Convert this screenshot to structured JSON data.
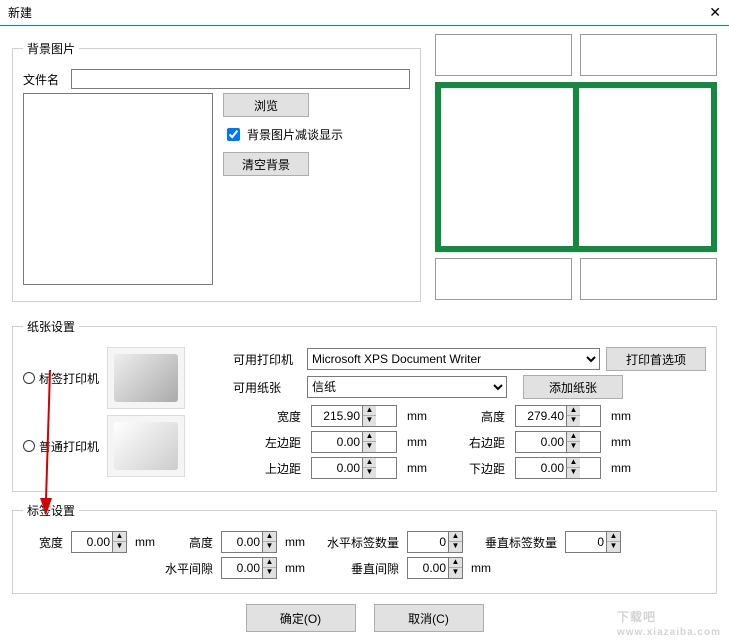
{
  "window": {
    "title": "新建"
  },
  "bg_image": {
    "legend": "背景图片",
    "filename_label": "文件名",
    "filename_value": "",
    "browse_btn": "浏览",
    "fade_checkbox": "背景图片减谈显示",
    "fade_checked": true,
    "clear_btn": "清空背景"
  },
  "paper": {
    "legend": "纸张设置",
    "radio_label_printer": "标签打印机",
    "radio_normal_printer": "普通打印机",
    "avail_printer_label": "可用打印机",
    "avail_printer_value": "Microsoft XPS Document Writer",
    "print_pref_btn": "打印首选项",
    "avail_paper_label": "可用纸张",
    "avail_paper_value": "信纸",
    "add_paper_btn": "添加纸张",
    "width_label": "宽度",
    "width_value": "215.90",
    "width_unit": "mm",
    "height_label": "高度",
    "height_value": "279.40",
    "height_unit": "mm",
    "left_label": "左边距",
    "left_value": "0.00",
    "left_unit": "mm",
    "right_label": "右边距",
    "right_value": "0.00",
    "right_unit": "mm",
    "top_label": "上边距",
    "top_value": "0.00",
    "top_unit": "mm",
    "bottom_label": "下边距",
    "bottom_value": "0.00",
    "bottom_unit": "mm"
  },
  "label": {
    "legend": "标签设置",
    "width_label": "宽度",
    "width_value": "0.00",
    "width_unit": "mm",
    "height_label": "高度",
    "height_value": "0.00",
    "height_unit": "mm",
    "hcount_label": "水平标签数量",
    "hcount_value": "0",
    "vcount_label": "垂直标签数量",
    "vcount_value": "0",
    "hgap_label": "水平间隙",
    "hgap_value": "0.00",
    "hgap_unit": "mm",
    "vgap_label": "垂直间隙",
    "vgap_value": "0.00",
    "vgap_unit": "mm"
  },
  "buttons": {
    "ok": "确定(O)",
    "cancel": "取消(C)"
  },
  "watermark": {
    "text": "下载吧",
    "url": "www.xiazaiba.com"
  }
}
